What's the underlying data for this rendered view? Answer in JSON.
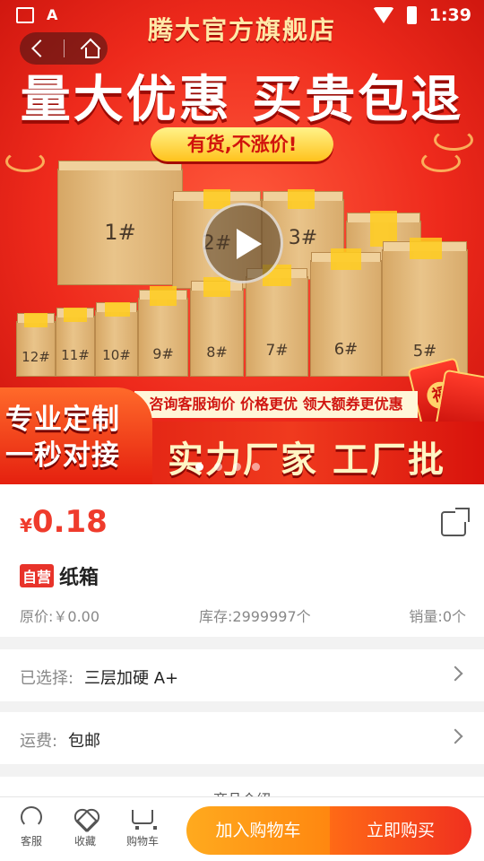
{
  "status_bar": {
    "time": "1:39"
  },
  "hero": {
    "store_name": "腾大官方旗舰店",
    "headline": "量大优惠 买贵包退",
    "subhead": "有货,不涨价!",
    "boxes": [
      "1#",
      "2#",
      "3#",
      "12#",
      "11#",
      "10#",
      "9#",
      "8#",
      "7#",
      "6#",
      "5#"
    ],
    "promo_strip": "咨询客服询价 价格更优 领大额券更优惠",
    "custom_line1": "专业定制",
    "custom_line2": "一秒对接",
    "factory_text": "实力厂家 工厂批发",
    "envelope_char": "福",
    "dot_count": 4,
    "active_dot": 0
  },
  "product": {
    "currency": "¥",
    "price": "0.18",
    "badge": "自营",
    "name": "纸箱",
    "original_price": "原价:￥0.00",
    "stock": "库存:2999997个",
    "sales": "销量:0个"
  },
  "selection": {
    "label": "已选择:",
    "value": "三层加硬 A+"
  },
  "shipping": {
    "label": "运费:",
    "value": "包邮"
  },
  "detail_peek": "商品介绍",
  "bottom_bar": {
    "service": "客服",
    "favorite": "收藏",
    "cart": "购物车",
    "add_to_cart": "加入购物车",
    "buy_now": "立即购买"
  },
  "colors": {
    "price": "#ef3b2c",
    "accent_orange": "#ff8710",
    "accent_red": "#f0301f"
  }
}
